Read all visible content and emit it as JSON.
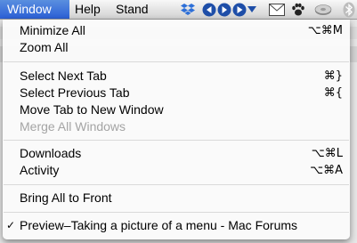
{
  "menubar": {
    "active_menu": "Window",
    "menus": [
      "Window",
      "Help",
      "Stand"
    ],
    "extras_icons": [
      "dropbox-icon",
      "back-icon",
      "forward-icon",
      "play-icon",
      "dropdown-arrow-icon",
      "mail-icon",
      "paw-icon",
      "drive-icon",
      "bluetooth-icon"
    ],
    "accent_color": "#2b5fd6"
  },
  "menu": {
    "items": [
      {
        "label": "Minimize All",
        "shortcut": "⌥⌘M",
        "enabled": true
      },
      {
        "label": "Zoom All",
        "shortcut": "",
        "enabled": true
      },
      {
        "label": "Select Next Tab",
        "shortcut": "⌘}",
        "enabled": true
      },
      {
        "label": "Select Previous Tab",
        "shortcut": "⌘{",
        "enabled": true
      },
      {
        "label": "Move Tab to New Window",
        "shortcut": "",
        "enabled": true
      },
      {
        "label": "Merge All Windows",
        "shortcut": "",
        "enabled": false
      },
      {
        "label": "Downloads",
        "shortcut": "⌥⌘L",
        "enabled": true
      },
      {
        "label": "Activity",
        "shortcut": "⌥⌘A",
        "enabled": true
      },
      {
        "label": "Bring All to Front",
        "shortcut": "",
        "enabled": true
      },
      {
        "label": "Preview–Taking a picture of a menu - Mac Forums",
        "shortcut": "",
        "enabled": true,
        "checked": true,
        "check_mark": "✓"
      }
    ]
  }
}
